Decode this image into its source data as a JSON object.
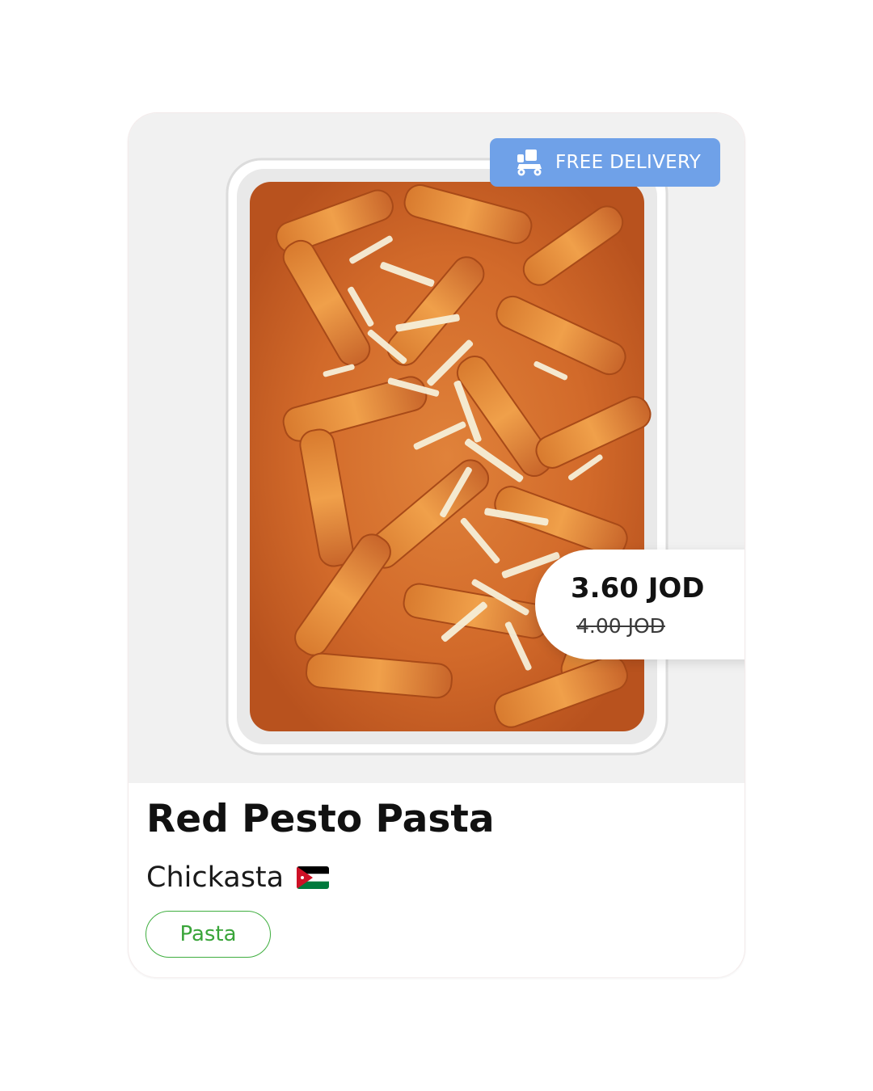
{
  "product": {
    "name": "Red Pesto Pasta",
    "restaurant": "Chickasta",
    "restaurant_flag_icon": "jordan-flag-icon",
    "category_tag": "Pasta",
    "badge": "FREE DELIVERY",
    "badge_icon": "delivery-scooter-icon",
    "price_current": "3.60 JOD",
    "price_original": "4.00 JOD"
  },
  "colors": {
    "badge_bg": "#6fa1e8",
    "tag_green": "#3aa53a",
    "image_bg": "#f1f1f1"
  }
}
